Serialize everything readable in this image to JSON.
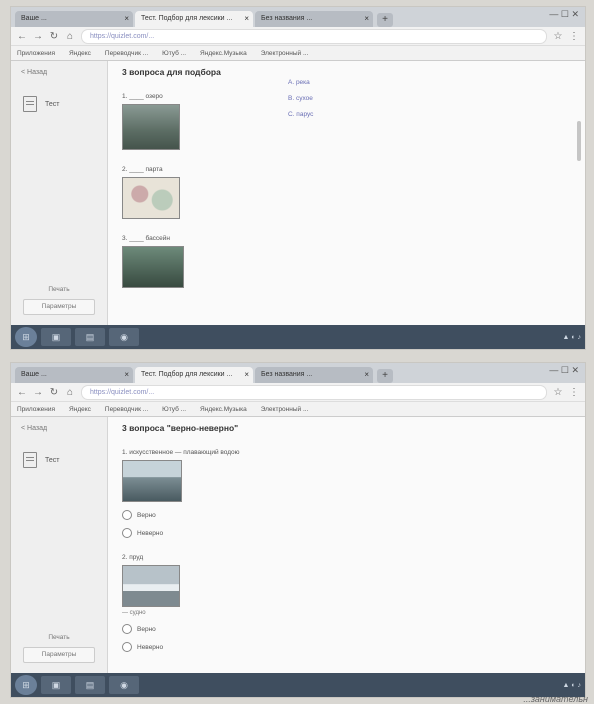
{
  "screen1": {
    "tabs": [
      "Ваше ... ",
      "Тест. Подбор для лексики ...",
      "Без названия ..."
    ],
    "url": "https://quizlet.com/...",
    "bookmarks": [
      "Приложения",
      "Яндекс",
      "Переводчик ...",
      "Ютуб ...",
      "Яндекс.Музыка",
      "Электронный ..."
    ],
    "sidebar": {
      "back": "< Назад",
      "item": "Тест",
      "footer": "Печать",
      "button": "Параметры"
    },
    "heading": "3 вопроса для подбора",
    "questions": [
      {
        "label": "1. ____ озеро"
      },
      {
        "label": "2. ____ парта"
      },
      {
        "label": "3. ____ бассейн"
      }
    ],
    "answers": [
      "A. река",
      "B. сухое",
      "C. парус"
    ]
  },
  "screen2": {
    "tabs": [
      "Ваше ... ",
      "Тест. Подбор для лексики ...",
      "Без названия ..."
    ],
    "url": "https://quizlet.com/...",
    "bookmarks": [
      "Приложения",
      "Яндекс",
      "Переводчик ...",
      "Ютуб ...",
      "Яндекс.Музыка",
      "Электронный ..."
    ],
    "sidebar": {
      "back": "< Назад",
      "item": "Тест",
      "footer": "Печать",
      "button": "Параметры"
    },
    "heading": "3 вопроса \"верно-неверно\"",
    "q1": "1. искусственное — плавающий водою",
    "q2": "2. пруд",
    "q2_caption": "— судно",
    "options": {
      "true": "Верно",
      "false": "Неверно"
    }
  },
  "bottom_text": "...занимательн"
}
